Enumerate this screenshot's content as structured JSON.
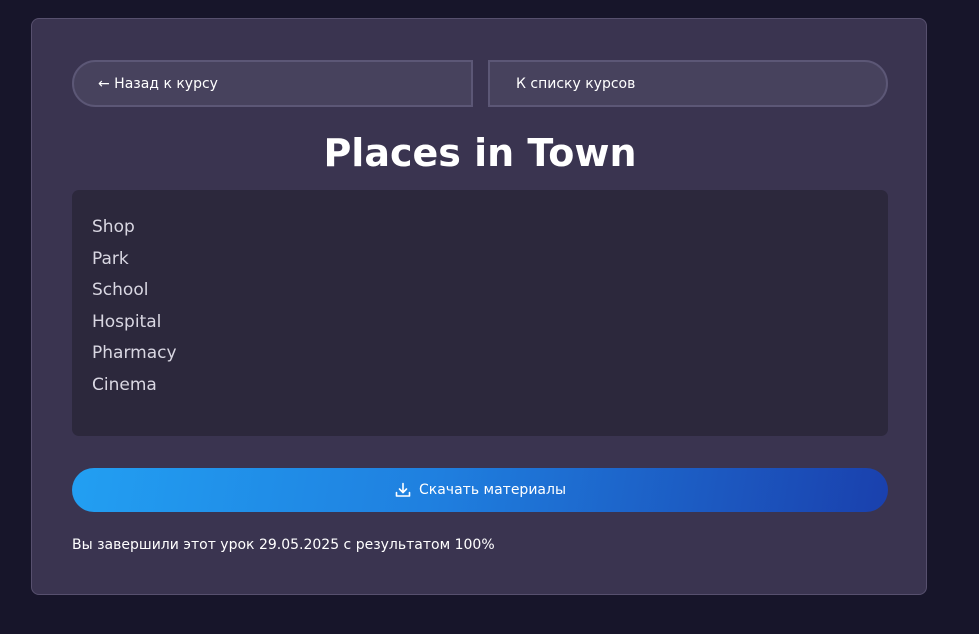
{
  "nav": {
    "back_label": "← Назад к курсу",
    "list_label": "К списку курсов"
  },
  "lesson": {
    "title": "Places in Town",
    "items": [
      "Shop",
      "Park",
      "School",
      "Hospital",
      "Pharmacy",
      "Cinema"
    ]
  },
  "download": {
    "label": "Скачать материалы",
    "icon": "download-icon"
  },
  "status": {
    "text": "Вы завершили этот урок 29.05.2025 с результатом 100%"
  },
  "colors": {
    "page_bg": "#17152a",
    "card_bg": "#3a3450",
    "content_bg": "#2c283c",
    "button_gradient_start": "#229ff2",
    "button_gradient_end": "#1a40ad"
  }
}
